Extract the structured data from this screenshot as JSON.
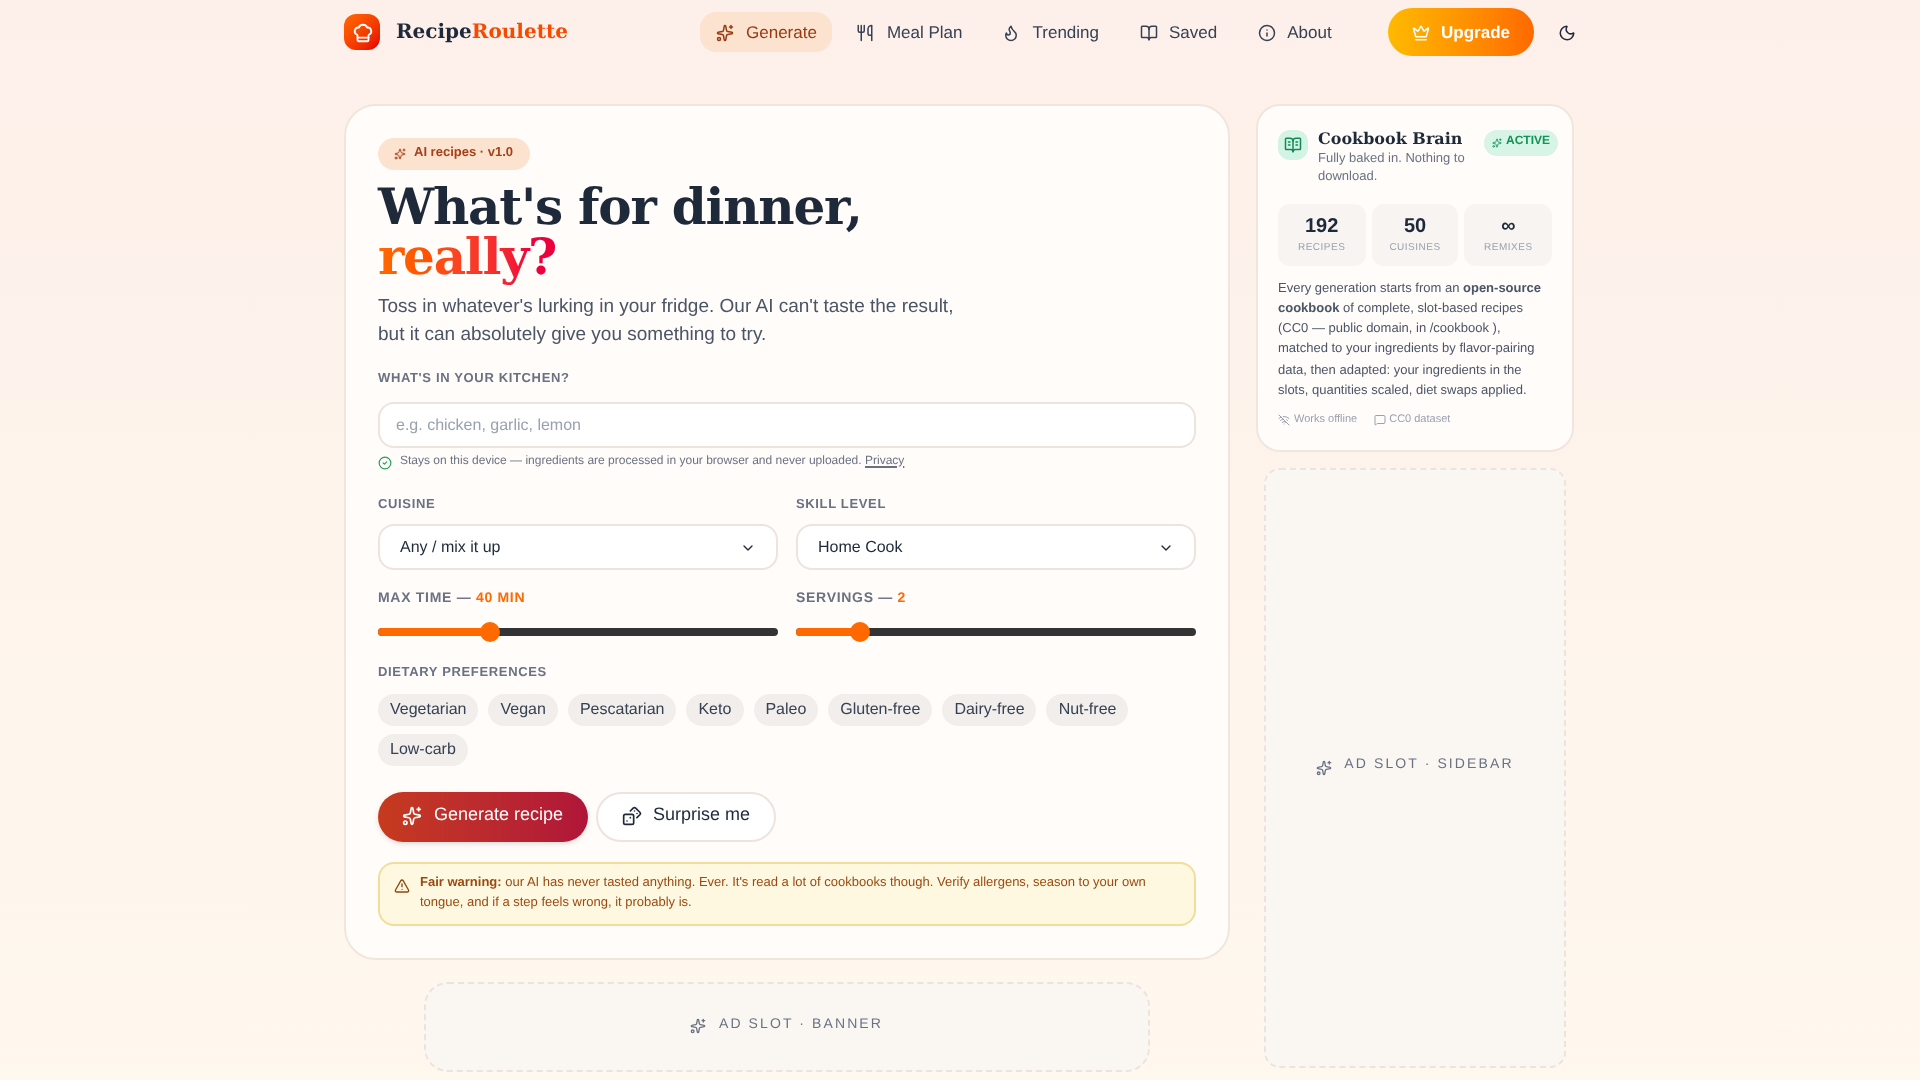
{
  "brand": {
    "name_first": "Recipe",
    "name_second": "Roulette"
  },
  "nav": [
    {
      "label": "Generate",
      "selected": true
    },
    {
      "label": "Meal Plan",
      "selected": false
    },
    {
      "label": "Trending",
      "selected": false
    },
    {
      "label": "Saved",
      "selected": false
    },
    {
      "label": "About",
      "selected": false
    }
  ],
  "upgrade_button": "Upgrade",
  "main": {
    "badge": "AI recipes · v1.0",
    "title_first": "What's for dinner,",
    "title_second": "really?",
    "intro": "Toss in whatever's lurking in your fridge. Our AI can't taste the result, but it can absolutely give you something to try.",
    "ingredients": {
      "label": "WHAT'S IN YOUR KITCHEN?",
      "placeholder": "e.g. chicken, garlic, lemon",
      "note": "Stays on this device — ingredients are processed in your browser and never uploaded.",
      "note_link": "Privacy"
    },
    "selects": [
      {
        "label": "CUISINE",
        "value": "Any / mix it up"
      },
      {
        "label": "SKILL LEVEL",
        "value": "Home Cook"
      }
    ],
    "sliders": [
      {
        "label": "MAX TIME —",
        "reading": "40 MIN",
        "level": 0.28
      },
      {
        "label": "SERVINGS —",
        "reading": "2",
        "level": 0.16
      }
    ],
    "dietary": {
      "label": "DIETARY PREFERENCES",
      "options": [
        {
          "label": "Vegetarian",
          "selected": false
        },
        {
          "label": "Vegan",
          "selected": false
        },
        {
          "label": "Pescatarian",
          "selected": false
        },
        {
          "label": "Keto",
          "selected": false
        },
        {
          "label": "Paleo",
          "selected": false
        },
        {
          "label": "Gluten-free",
          "selected": false
        },
        {
          "label": "Dairy-free",
          "selected": false
        },
        {
          "label": "Nut-free",
          "selected": false
        },
        {
          "label": "Low-carb",
          "selected": false
        }
      ]
    },
    "generate_button": "Generate recipe",
    "surprise_button": "Surprise me",
    "warning": "**Fair warning:** our AI has never tasted anything. Ever. It's read a lot of cookbooks though. Verify allergens, season to your own tongue, and if a step feels wrong, it probably is."
  },
  "banner_ad": "AD SLOT · BANNER",
  "brain": {
    "title": "Cookbook Brain",
    "subtitle": "Fully baked in. Nothing to download.",
    "status": "ACTIVE",
    "stats": [
      {
        "value": "192",
        "label": "RECIPES"
      },
      {
        "value": "50",
        "label": "CUISINES"
      },
      {
        "value": "∞",
        "label": "REMIXES"
      }
    ],
    "description": "Every generation starts from an **open-source cookbook** of complete, slot-based recipes (CC0 — public domain, in  /cookbook ), matched to your ingredients by flavor-pairing data, then adapted: your ingredients in the slots, quantities scaled, diet swaps applied.",
    "footer": [
      "Works offline",
      "CC0 dataset"
    ]
  },
  "sidebar_ad": "AD SLOT · SIDEBAR"
}
